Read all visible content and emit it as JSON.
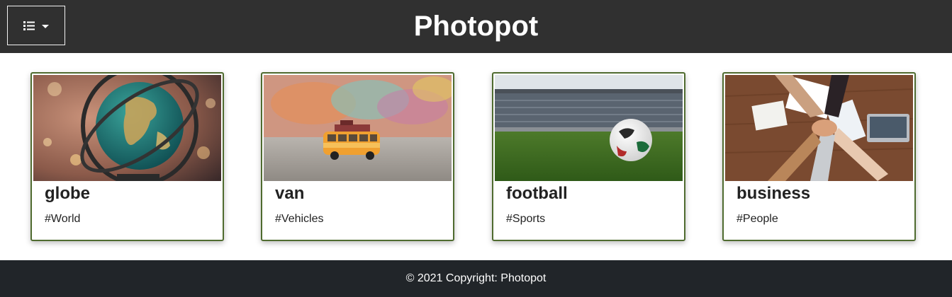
{
  "header": {
    "title": "Photopot",
    "menu_icon": "list-icon",
    "dropdown_icon": "caret-down-icon"
  },
  "cards": [
    {
      "name": "globe",
      "tag": "#World",
      "image": "globe-photo"
    },
    {
      "name": "van",
      "tag": "#Vehicles",
      "image": "toy-van-photo"
    },
    {
      "name": "football",
      "tag": "#Sports",
      "image": "soccer-ball-stadium-photo"
    },
    {
      "name": "business",
      "tag": "#People",
      "image": "team-hands-photo"
    }
  ],
  "footer": {
    "copyright": "© 2021 Copyright: Photopot"
  },
  "colors": {
    "header_bg": "#303030",
    "footer_bg": "#212529",
    "card_border": "#4f6b2f"
  }
}
